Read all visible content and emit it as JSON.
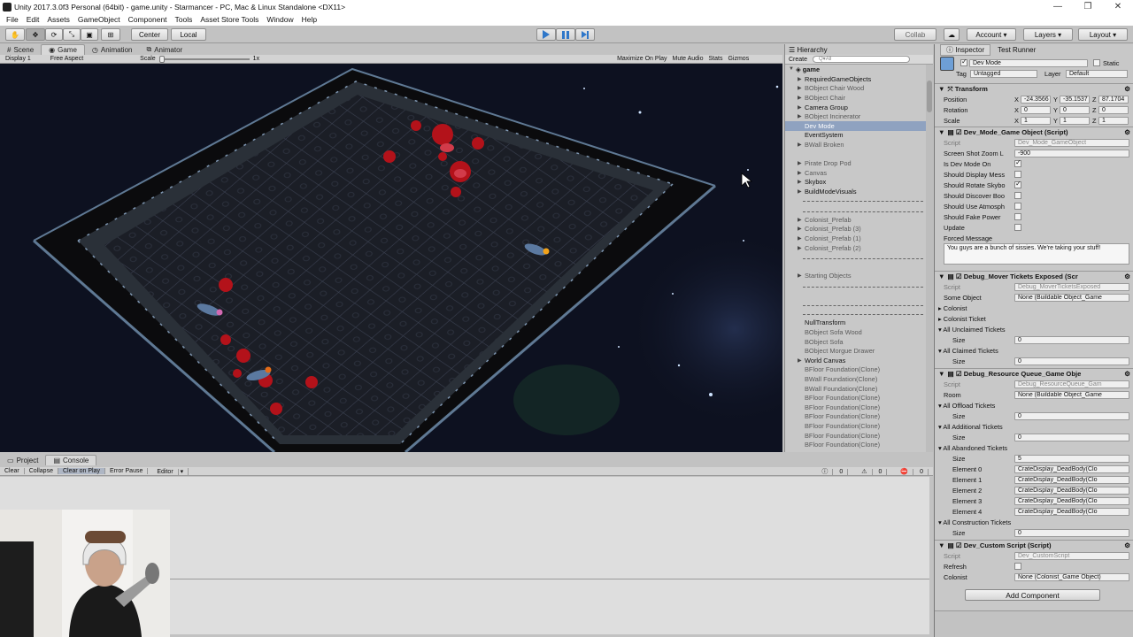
{
  "titlebar": {
    "title": "Unity 2017.3.0f3 Personal (64bit) - game.unity - Starmancer - PC, Mac & Linux Standalone <DX11>"
  },
  "menu": [
    "File",
    "Edit",
    "Assets",
    "GameObject",
    "Component",
    "Tools",
    "Asset Store Tools",
    "Window",
    "Help"
  ],
  "toolbar": {
    "center": "Center",
    "local": "Local",
    "collab": "Collab",
    "account": "Account",
    "layers": "Layers",
    "layout": "Layout"
  },
  "game_tabs": {
    "scene": "Scene",
    "game": "Game",
    "animation": "Animation",
    "animator": "Animator"
  },
  "game_bar": {
    "display": "Display 1",
    "aspect": "Free Aspect",
    "scale_label": "Scale",
    "scale_value": "1x",
    "maximize": "Maximize On Play",
    "mute": "Mute Audio",
    "stats": "Stats",
    "gizmos": "Gizmos"
  },
  "hierarchy": {
    "title": "Hierarchy",
    "create": "Create",
    "search": "Q▾All",
    "root": "game",
    "items": [
      {
        "label": "RequiredGameObjects",
        "arrow": true
      },
      {
        "label": "BObject Chair Wood",
        "arrow": true,
        "grey": true
      },
      {
        "label": "BObject Chair",
        "arrow": true,
        "grey": true
      },
      {
        "label": "Camera Group",
        "arrow": true
      },
      {
        "label": "BObject Incinerator",
        "arrow": true,
        "grey": true
      },
      {
        "label": "Dev Mode",
        "selected": true
      },
      {
        "label": "EventSystem"
      },
      {
        "label": "BWall Broken",
        "arrow": true,
        "grey": true
      },
      {
        "label": "Pirate Drop Pod",
        "arrow": true,
        "grey": true
      },
      {
        "label": "Canvas",
        "arrow": true,
        "grey": true
      },
      {
        "label": "Skybox",
        "arrow": true
      },
      {
        "label": "BuildModeVisuals",
        "arrow": true
      },
      {
        "label": "Colonist_Prefab",
        "arrow": true,
        "grey": true
      },
      {
        "label": "Colonist_Prefab (3)",
        "arrow": true,
        "grey": true
      },
      {
        "label": "Colonist_Prefab (1)",
        "arrow": true,
        "grey": true
      },
      {
        "label": "Colonist_Prefab (2)",
        "arrow": true,
        "grey": true
      },
      {
        "label": "Starting Objects",
        "arrow": true,
        "grey": true
      },
      {
        "label": "NullTransform"
      },
      {
        "label": "BObject Sofa Wood",
        "grey": true
      },
      {
        "label": "BObject Sofa",
        "grey": true
      },
      {
        "label": "BObject Morgue Drawer",
        "grey": true
      },
      {
        "label": "World Canvas",
        "arrow": true
      },
      {
        "label": "BFloor Foundation(Clone)",
        "grey": true
      },
      {
        "label": "BWall Foundation(Clone)",
        "grey": true
      },
      {
        "label": "BWall Foundation(Clone)",
        "grey": true
      },
      {
        "label": "BFloor Foundation(Clone)",
        "grey": true
      },
      {
        "label": "BFloor Foundation(Clone)",
        "grey": true
      },
      {
        "label": "BFloor Foundation(Clone)",
        "grey": true
      },
      {
        "label": "BFloor Foundation(Clone)",
        "grey": true
      },
      {
        "label": "BFloor Foundation(Clone)",
        "grey": true
      },
      {
        "label": "BFloor Foundation(Clone)",
        "grey": true
      }
    ]
  },
  "inspector": {
    "tab": "Inspector",
    "tab2": "Test Runner",
    "object_name": "Dev Mode",
    "static": "Static",
    "tag_label": "Tag",
    "tag": "Untagged",
    "layer_label": "Layer",
    "layer": "Default",
    "transform": {
      "title": "Transform",
      "position": "Position",
      "rotation": "Rotation",
      "scale": "Scale",
      "pos": [
        "-24.3566",
        "-35.1537",
        "87.1704"
      ],
      "rot": [
        "0",
        "0",
        "0"
      ],
      "scl": [
        "1",
        "1",
        "1"
      ]
    },
    "dev_mode": {
      "title": "Dev_Mode_Game Object (Script)",
      "script_label": "Script",
      "script": "Dev_Mode_GameObject",
      "zoom_label": "Screen Shot Zoom L",
      "zoom": "-900",
      "fields": [
        {
          "label": "Is Dev Mode On",
          "on": true
        },
        {
          "label": "Should Display Mess",
          "on": false
        },
        {
          "label": "Should Rotate Skybo",
          "on": true
        },
        {
          "label": "Should Discover Boo",
          "on": false
        },
        {
          "label": "Should Use Atmosph",
          "on": false
        },
        {
          "label": "Should Fake Power",
          "on": false
        },
        {
          "label": "Update",
          "on": false
        }
      ],
      "forced_label": "Forced Message",
      "forced": "You guys are a bunch of sissies. We're taking your stuff!"
    },
    "mover": {
      "title": "Debug_Mover Tickets Exposed (Scr",
      "script": "Debug_MoverTicketsExposed",
      "some_label": "Some Object",
      "some": "None (Buildable Object_Game",
      "colonist": "Colonist",
      "colonist_ticket": "Colonist Ticket",
      "unclaimed": "All Unclaimed Tickets",
      "claimed": "All Claimed Tickets",
      "size_label": "Size",
      "size_unclaimed": "0",
      "size_claimed": "0"
    },
    "resource": {
      "title": "Debug_Resource Queue_Game Obje",
      "script": "Debug_ResourceQueue_Gam",
      "room_label": "Room",
      "room": "None (Buildable Object_Game",
      "offload": "All Offload Tickets",
      "additional": "All Additional Tickets",
      "abandoned": "All Abandoned Tickets",
      "construction": "All Construction Tickets",
      "size_offload": "0",
      "size_additional": "0",
      "size_abandoned": "5",
      "size_construction": "0",
      "elements": [
        {
          "label": "Element 0",
          "value": "CrateDisplay_DeadBody(Clo"
        },
        {
          "label": "Element 1",
          "value": "CrateDisplay_DeadBody(Clo"
        },
        {
          "label": "Element 2",
          "value": "CrateDisplay_DeadBody(Clo"
        },
        {
          "label": "Element 3",
          "value": "CrateDisplay_DeadBody(Clo"
        },
        {
          "label": "Element 4",
          "value": "CrateDisplay_DeadBody(Clo"
        }
      ]
    },
    "custom": {
      "title": "Dev_Custom Script (Script)",
      "script": "Dev_CustomScript",
      "refresh": "Refresh",
      "colonist": "Colonist",
      "colonist_value": "None (Colonist_Game Object)"
    },
    "add_component": "Add Component"
  },
  "bottom": {
    "project": "Project",
    "console": "Console",
    "clear": "Clear",
    "collapse": "Collapse",
    "clear_on_play": "Clear on Play",
    "error_pause": "Error Pause",
    "editor": "Editor",
    "count_log": "0",
    "count_warn": "0",
    "count_err": "0"
  }
}
